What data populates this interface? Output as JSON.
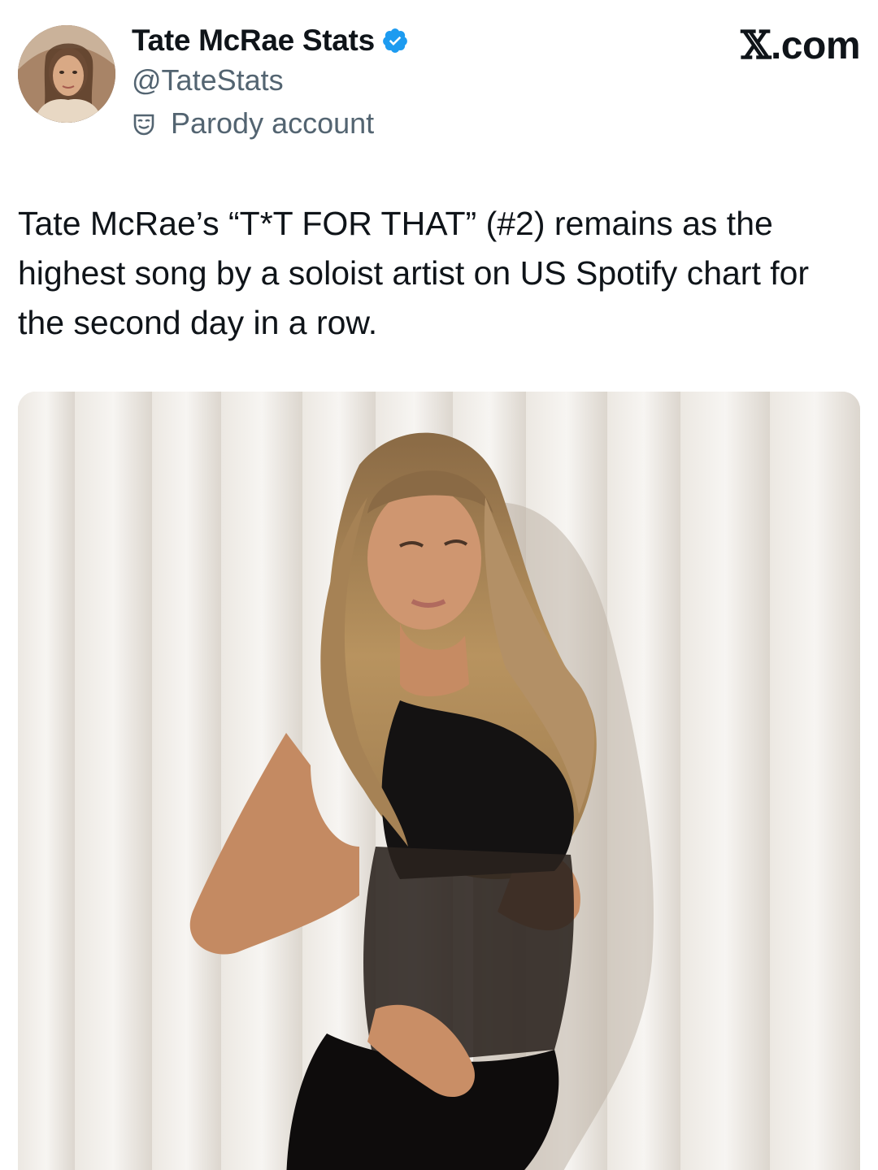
{
  "account": {
    "display_name": "Tate McRae Stats",
    "handle": "@TateStats",
    "label": "Parody account",
    "verified_icon": "verified-badge-icon",
    "label_icon": "parody-mask-icon"
  },
  "brand": {
    "x_glyph": "𝕏",
    "suffix": ".com"
  },
  "tweet": {
    "text": "Tate McRae’s “T*T FOR THAT” (#2) remains as the highest song by a soloist artist on US Spotify chart for the second day in a row."
  },
  "colors": {
    "verified": "#1d9bf0",
    "secondary_text": "#536471"
  }
}
